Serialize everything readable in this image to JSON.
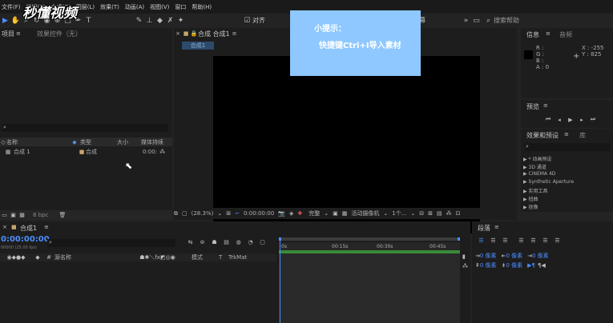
{
  "menu": [
    "文件(F)",
    "编辑(E)",
    "合成(C)",
    "图层(L)",
    "效果(T)",
    "动画(A)",
    "视图(V)",
    "窗口",
    "帮助(H)"
  ],
  "watermark": "秒懂视频",
  "toolbar": {
    "snap_label": "对齐",
    "small_screen": "小屏幕",
    "search_placeholder": "搜索帮助"
  },
  "project": {
    "tab_project": "项目",
    "tab_effects": "效果控件（无）",
    "col_name": "名称",
    "col_type": "类型",
    "col_size": "大小",
    "col_duration": "媒体持续",
    "item_name": "合成 1",
    "item_type": "合成",
    "item_duration": "0:00:",
    "bpc": "8 bpc"
  },
  "comp": {
    "tab_label": "合成 合成1",
    "subtab": "合成1",
    "zoom": "(28.3%)",
    "timecode": "0:00:00:00",
    "quality": "完整",
    "camera": "活动摄像机",
    "views": "1个..."
  },
  "tip": {
    "title": "小提示：",
    "text": "快捷键Ctrl+I导入素材"
  },
  "info": {
    "tab": "信息",
    "tab2": "音频",
    "r": "R :",
    "g": "G :",
    "b": "B :",
    "a": "A : 0",
    "x": "X : -255",
    "y": "Y : 825"
  },
  "preview": {
    "tab": "预览"
  },
  "effects": {
    "tab": "效果和预设",
    "tab2": "库",
    "items": [
      "▶ * 动画预设",
      "▶ 3D 通道",
      "▶ CINEMA 4D",
      "▶ Synthetic Aperture",
      "▶ 实用工具",
      "▶ 扭曲",
      "▶ 抠像"
    ]
  },
  "timeline": {
    "tab": "合成1",
    "timecode": "0:00:00:00",
    "fps": "00000 (25.00 fps)",
    "col_source": "源名称",
    "col_mode": "模式",
    "col_t": "T",
    "col_trkmat": "TrkMat",
    "ticks": [
      "0s",
      "00:15s",
      "00:30s",
      "00:45s"
    ]
  },
  "paragraph": {
    "tab": "段落",
    "px": "0 像素"
  },
  "colors": {
    "accent": "#4c8dff",
    "tip_bg": "#8ec8ff"
  }
}
